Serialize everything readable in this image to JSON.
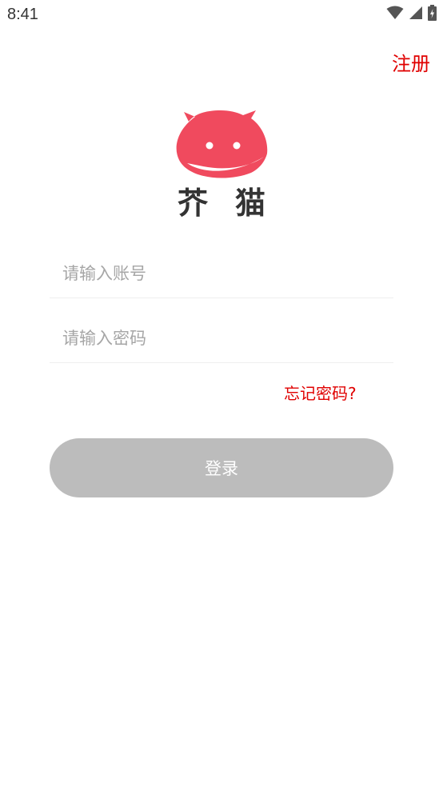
{
  "status_bar": {
    "time": "8:41",
    "icons": [
      "wifi-icon",
      "cellular-signal-icon",
      "battery-charging-icon"
    ]
  },
  "header": {
    "register_label": "注册"
  },
  "logo": {
    "text_left": "芥",
    "text_right": "猫",
    "brand_color": "#f04a5e"
  },
  "form": {
    "account_placeholder": "请输入账号",
    "account_value": "",
    "password_placeholder": "请输入密码",
    "password_value": "",
    "forgot_label": "忘记密码?",
    "login_label": "登录"
  },
  "colors": {
    "accent": "#e00000",
    "button_disabled": "#bcbcbc"
  }
}
